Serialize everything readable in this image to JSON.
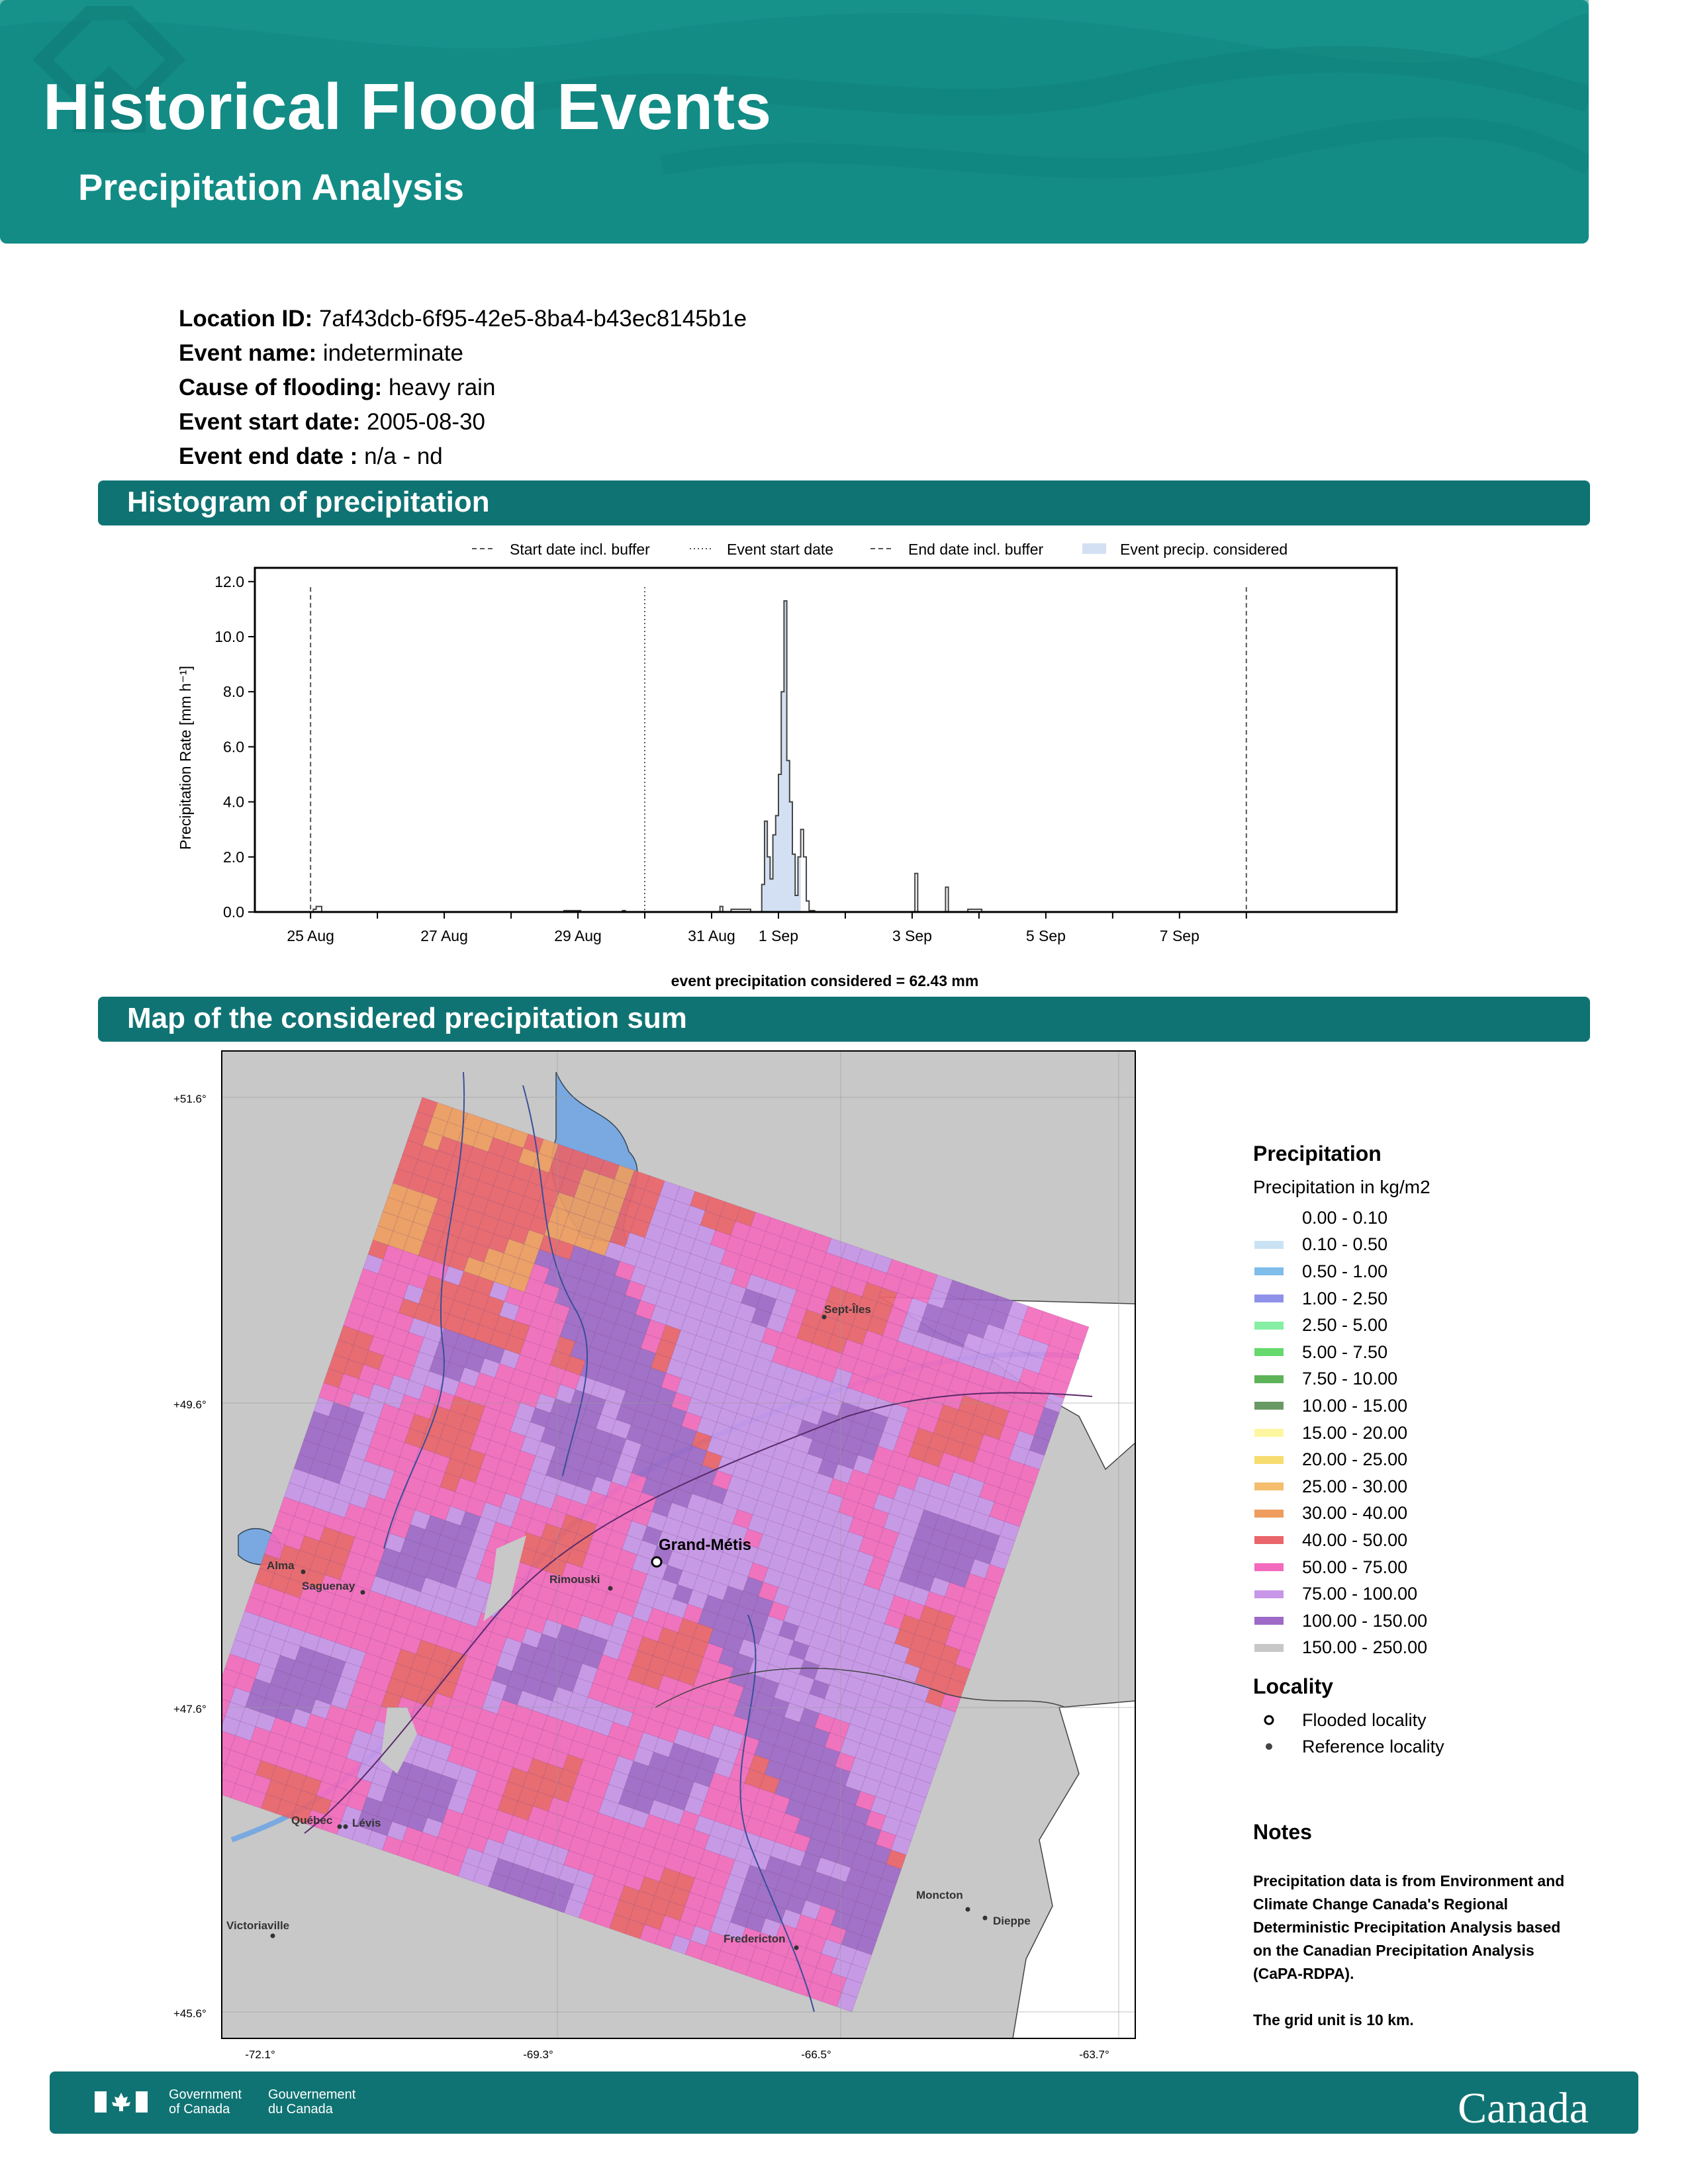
{
  "header": {
    "title": "Historical Flood Events",
    "subtitle": "Precipitation Analysis"
  },
  "info": [
    {
      "label": "Location ID:",
      "value": "7af43dcb-6f95-42e5-8ba4-b43ec8145b1e"
    },
    {
      "label": "Event name:",
      "value": "indeterminate"
    },
    {
      "label": "Cause of flooding:",
      "value": "heavy rain"
    },
    {
      "label": "Event start date:",
      "value": "2005-08-30"
    },
    {
      "label": "Event end date :",
      "value": "n/a - nd"
    }
  ],
  "sections": {
    "histogram": "Histogram of precipitation",
    "map": "Map of the considered precipitation sum"
  },
  "chart_data": {
    "type": "area",
    "ylabel": "Precipitation Rate [mm h⁻¹]",
    "xlabel": "event precipitation considered = 62.43 mm",
    "ylim": [
      0,
      12.5
    ],
    "yticks": [
      0.0,
      2.0,
      4.0,
      6.0,
      8.0,
      10.0,
      12.0
    ],
    "ytick_labels": [
      "0.0",
      "2.0",
      "4.0",
      "6.0",
      "8.0",
      "10.0",
      "12.0"
    ],
    "xlim_hours": [
      -20,
      390
    ],
    "xticks": [
      {
        "hour": 0,
        "label": "25 Aug"
      },
      {
        "hour": 48,
        "label": "27 Aug"
      },
      {
        "hour": 96,
        "label": "29 Aug"
      },
      {
        "hour": 144,
        "label": "31 Aug"
      },
      {
        "hour": 168,
        "label": "1 Sep"
      },
      {
        "hour": 216,
        "label": "3 Sep"
      },
      {
        "hour": 264,
        "label": "5 Sep"
      },
      {
        "hour": 312,
        "label": "7 Sep"
      }
    ],
    "legend": [
      "Start date incl. buffer",
      "Event start date",
      "End date incl. buffer",
      "Event precip. considered"
    ],
    "vlines": [
      {
        "hour": 0,
        "style": "dashed",
        "series": "Start date incl. buffer"
      },
      {
        "hour": 120,
        "style": "dotted",
        "series": "Event start date"
      },
      {
        "hour": 336,
        "style": "dashed",
        "series": "End date incl. buffer"
      }
    ],
    "shade_range_hours": [
      162,
      176
    ],
    "series": [
      {
        "name": "Event precip. considered",
        "points": [
          [
            -20,
            0
          ],
          [
            0,
            0
          ],
          [
            1,
            0.1
          ],
          [
            2,
            0.2
          ],
          [
            4,
            0
          ],
          [
            90,
            0
          ],
          [
            91,
            0.05
          ],
          [
            96,
            0.05
          ],
          [
            97,
            0
          ],
          [
            111,
            0
          ],
          [
            112,
            0.05
          ],
          [
            113,
            0
          ],
          [
            146,
            0
          ],
          [
            147,
            0.2
          ],
          [
            148,
            0
          ],
          [
            150,
            0
          ],
          [
            151,
            0.1
          ],
          [
            157,
            0.1
          ],
          [
            158,
            0
          ],
          [
            161,
            0
          ],
          [
            162,
            1.0
          ],
          [
            163,
            3.3
          ],
          [
            164,
            2.0
          ],
          [
            165,
            1.2
          ],
          [
            166,
            2.8
          ],
          [
            167,
            3.5
          ],
          [
            168,
            5.0
          ],
          [
            169,
            8.0
          ],
          [
            170,
            11.3
          ],
          [
            171,
            5.5
          ],
          [
            172,
            4.0
          ],
          [
            173,
            2.1
          ],
          [
            174,
            0.6
          ],
          [
            175,
            2.0
          ],
          [
            176,
            3.0
          ],
          [
            177,
            2.0
          ],
          [
            178,
            0.4
          ],
          [
            179,
            0.05
          ],
          [
            181,
            0
          ],
          [
            216,
            0
          ],
          [
            217,
            1.4
          ],
          [
            218,
            0
          ],
          [
            227,
            0
          ],
          [
            228,
            0.9
          ],
          [
            229,
            0
          ],
          [
            235,
            0
          ],
          [
            236,
            0.1
          ],
          [
            240,
            0.1
          ],
          [
            241,
            0
          ],
          [
            390,
            0
          ]
        ]
      }
    ]
  },
  "map": {
    "lat_labels": [
      "+51.6°",
      "+49.6°",
      "+47.6°",
      "+45.6°"
    ],
    "lon_labels": [
      "-72.1°",
      "-69.3°",
      "-66.5°",
      "-63.7°"
    ],
    "flooded_locality": "Grand-Métis",
    "reference_localities": [
      "Sept-Îles",
      "Alma",
      "Saguenay",
      "Rimouski",
      "Québec",
      "Lévis",
      "Victoriaville",
      "Moncton",
      "Dieppe",
      "Fredericton"
    ]
  },
  "legend": {
    "title": "Precipitation",
    "subtitle": "Precipitation in kg/m2",
    "classes": [
      {
        "label": "0.00 - 0.10",
        "color": "#ffffff"
      },
      {
        "label": "0.10 - 0.50",
        "color": "#c9e3f5"
      },
      {
        "label": "0.50 - 1.00",
        "color": "#7fbdeb"
      },
      {
        "label": "1.00 - 2.50",
        "color": "#8f92e8"
      },
      {
        "label": "2.50 - 5.00",
        "color": "#86efa3"
      },
      {
        "label": "5.00 - 7.50",
        "color": "#66d96d"
      },
      {
        "label": "7.50 - 10.00",
        "color": "#5db357"
      },
      {
        "label": "10.00 - 15.00",
        "color": "#6a9a63"
      },
      {
        "label": "15.00 - 20.00",
        "color": "#fdf6a0"
      },
      {
        "label": "20.00 - 25.00",
        "color": "#f7dc70"
      },
      {
        "label": "25.00 - 30.00",
        "color": "#f4be6e"
      },
      {
        "label": "30.00 - 40.00",
        "color": "#ee9d5e"
      },
      {
        "label": "40.00 - 50.00",
        "color": "#e9656a"
      },
      {
        "label": "50.00 - 75.00",
        "color": "#f36bbd"
      },
      {
        "label": "75.00 - 100.00",
        "color": "#c796e8"
      },
      {
        "label": "100.00 - 150.00",
        "color": "#9d6ac7"
      },
      {
        "label": "150.00 - 250.00",
        "color": "#c8c8c8"
      }
    ],
    "locality_title": "Locality",
    "flooded_label": "Flooded locality",
    "reference_label": "Reference locality"
  },
  "notes": {
    "title": "Notes",
    "line1": "Precipitation data is from Environment and",
    "line2": "Climate Change Canada's Regional",
    "line3": "Deterministic Precipitation Analysis based",
    "line4": "on the Canadian Precipitation Analysis",
    "line5": "(CaPA-RDPA).",
    "line6": "The grid unit is 10 km."
  },
  "footer": {
    "gov_en_1": "Government",
    "gov_en_2": "of Canada",
    "gov_fr_1": "Gouvernement",
    "gov_fr_2": "du Canada",
    "wordmark": "Canada"
  },
  "colors": {
    "header": "#138c86",
    "section_bar": "#107373",
    "footer": "#107373"
  }
}
